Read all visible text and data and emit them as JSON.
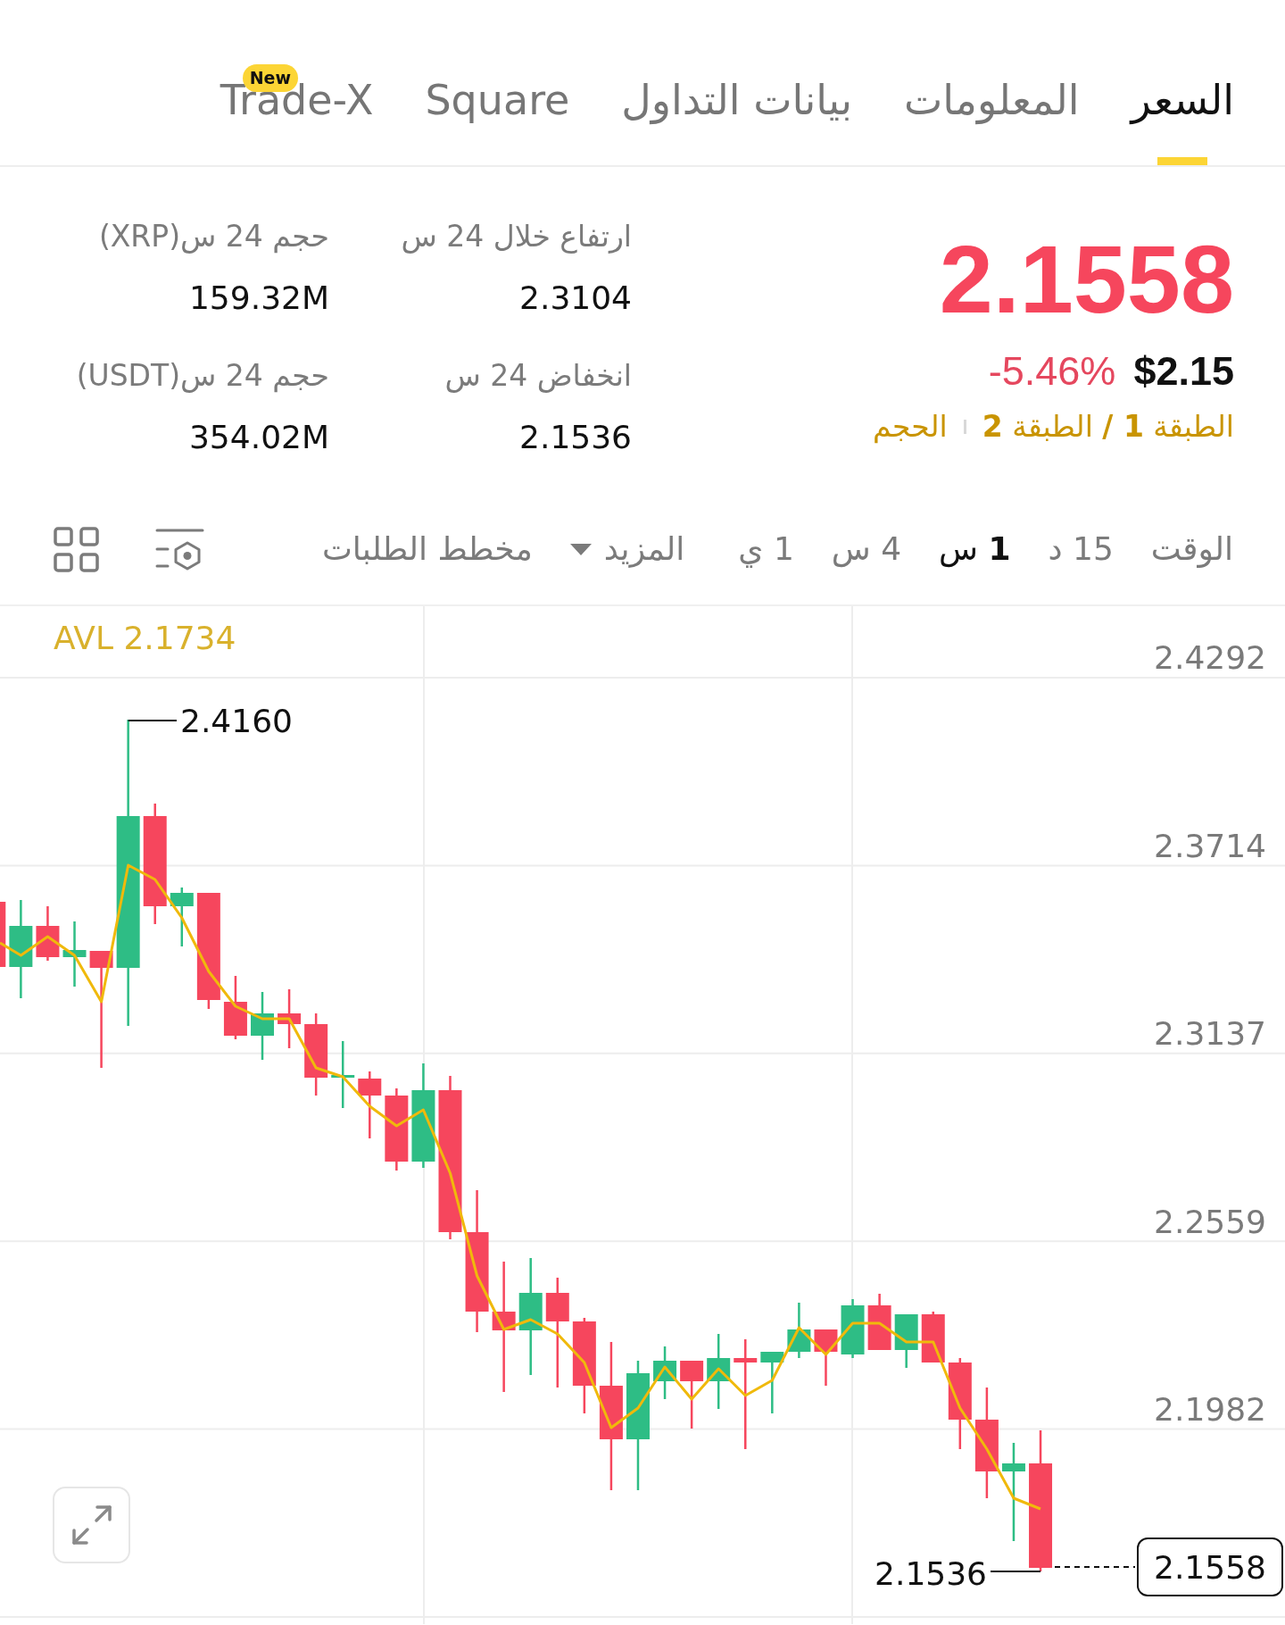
{
  "tabs": [
    {
      "label": "السعر",
      "selected": true
    },
    {
      "label": "المعلومات",
      "selected": false
    },
    {
      "label": "بيانات التداول",
      "selected": false
    },
    {
      "label": "Square",
      "selected": false
    },
    {
      "label": "Trade-X",
      "selected": false,
      "badge": "New"
    }
  ],
  "price": {
    "last": "2.1558",
    "usd": "$2.15",
    "change": "-5.46%",
    "tags": [
      "الطبقة **1 /** الطبقة **2**",
      "الحجم"
    ]
  },
  "stats": [
    {
      "label": "ارتفاع خلال 24 س",
      "value": "2.3104"
    },
    {
      "label": "حجم 24 س(XRP)",
      "value": "159.32M"
    },
    {
      "label": "انخفاض 24 س",
      "value": "2.1536"
    },
    {
      "label": "حجم 24 س(USDT)",
      "value": "354.02M"
    }
  ],
  "toolbar": {
    "label": "الوقت",
    "intervals": [
      {
        "label": "15 د",
        "selected": false
      },
      {
        "label": "**1** س",
        "selected": true
      },
      {
        "label": "4 س",
        "selected": false
      },
      {
        "label": "1 ي",
        "selected": false
      }
    ],
    "more": "المزيد",
    "depth": "مخطط الطلبات"
  },
  "chart": {
    "indicator": "AVL 2.1734",
    "price_axis": [
      "2.4292",
      "2.3714",
      "2.3137",
      "2.2559",
      "2.1982"
    ],
    "high_label": "2.4160",
    "low_label": "2.1536",
    "current_price": "2.1558"
  }
}
